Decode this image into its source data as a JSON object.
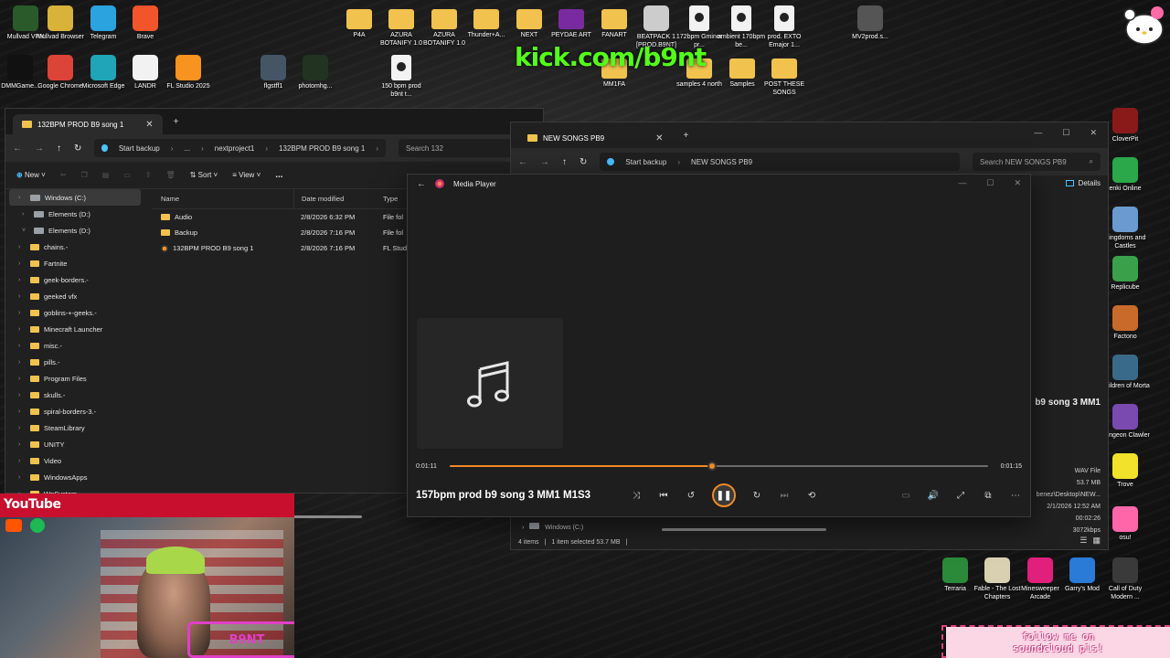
{
  "desktop": {
    "stream_logo": "kick.com/b9nt",
    "icons": [
      {
        "label": "Mullvad VPN",
        "kind": "app",
        "color": "#2a5a2a"
      },
      {
        "label": "Mullvad Browser",
        "kind": "app",
        "color": "#d9b23a"
      },
      {
        "label": "Telegram",
        "kind": "app",
        "color": "#2aa3df"
      },
      {
        "label": "Brave",
        "kind": "app",
        "color": "#f2552c"
      },
      {
        "label": "DMMGame...",
        "kind": "app",
        "color": "#111111"
      },
      {
        "label": "Google Chrome",
        "kind": "app",
        "color": "#db4437"
      },
      {
        "label": "Microsoft Edge",
        "kind": "app",
        "color": "#1fa4b8"
      },
      {
        "label": "LANDR",
        "kind": "app",
        "color": "#f2f2f2"
      },
      {
        "label": "FL Studio 2025",
        "kind": "app",
        "color": "#f7931e"
      },
      {
        "label": "flgstff1",
        "kind": "app",
        "color": "#445566"
      },
      {
        "label": "photomhg...",
        "kind": "app",
        "color": "#223322"
      },
      {
        "label": "150 bpm prod b9nt t...",
        "kind": "file",
        "color": "#f2f2f2"
      },
      {
        "label": "P4A",
        "kind": "folder",
        "color": "#f1c24d"
      },
      {
        "label": "AZURA BOTANIFY 1.0",
        "kind": "folder",
        "color": "#f1c24d"
      },
      {
        "label": "AZURA BOTANIFY 1.0",
        "kind": "folder",
        "color": "#f1c24d"
      },
      {
        "label": "Thunder+A...",
        "kind": "folder",
        "color": "#f1c24d"
      },
      {
        "label": "NEXT",
        "kind": "folder",
        "color": "#f1c24d"
      },
      {
        "label": "PEYDAE ART",
        "kind": "folder",
        "color": "#7a2aa0"
      },
      {
        "label": "FANART",
        "kind": "folder",
        "color": "#f1c24d"
      },
      {
        "label": "BEATPACK 1 [PROD.B9NT]",
        "kind": "app",
        "color": "#cccccc"
      },
      {
        "label": "172bpm Gminor pr...",
        "kind": "file",
        "color": "#f2f2f2"
      },
      {
        "label": "ambient 170bpm be...",
        "kind": "file",
        "color": "#f2f2f2"
      },
      {
        "label": "prod. EXTO Emajor 1...",
        "kind": "file",
        "color": "#f2f2f2"
      },
      {
        "label": "MV2prod.s...",
        "kind": "app",
        "color": "#555555"
      },
      {
        "label": "MM1FA",
        "kind": "folder",
        "color": "#f1c24d"
      },
      {
        "label": "samples 4 north",
        "kind": "folder",
        "color": "#f1c24d"
      },
      {
        "label": "Samples",
        "kind": "folder",
        "color": "#f1c24d"
      },
      {
        "label": "POST THESE SONGS",
        "kind": "folder",
        "color": "#f1c24d"
      },
      {
        "label": "CloverPit",
        "kind": "app",
        "color": "#8a1a1a"
      },
      {
        "label": "enki Online",
        "kind": "app",
        "color": "#2aa84a"
      },
      {
        "label": "Kingdoms and Castles",
        "kind": "app",
        "color": "#6a9ad0"
      },
      {
        "label": "Replicube",
        "kind": "app",
        "color": "#3aa04a"
      },
      {
        "label": "Factono",
        "kind": "app",
        "color": "#c86a2a"
      },
      {
        "label": "Children of Morta",
        "kind": "app",
        "color": "#3a6a8a"
      },
      {
        "label": "Dungeon Clawler",
        "kind": "app",
        "color": "#7a4ab0"
      },
      {
        "label": "Trove",
        "kind": "app",
        "color": "#f2e22a"
      },
      {
        "label": "osu!",
        "kind": "app",
        "color": "#ff66aa"
      },
      {
        "label": "Terraria",
        "kind": "app",
        "color": "#2a8a3a"
      },
      {
        "label": "Fable - The Lost Chapters",
        "kind": "app",
        "color": "#d8d0b0"
      },
      {
        "label": "Minesweeper Arcade",
        "kind": "app",
        "color": "#e0207a"
      },
      {
        "label": "Garry's Mod",
        "kind": "app",
        "color": "#2a7ad8"
      },
      {
        "label": "Call of Duty Modern ...",
        "kind": "app",
        "color": "#3a3a3a"
      }
    ]
  },
  "explorer1": {
    "tab_title": "132BPM PROD B9 song 1",
    "breadcrumb": [
      "Start backup",
      "...",
      "nextproject1",
      "132BPM PROD B9 song 1"
    ],
    "search_placeholder": "Search 132",
    "commands": {
      "new": "New",
      "sort": "Sort",
      "view": "View",
      "more": "..."
    },
    "tree": [
      {
        "label": "Windows (C:)",
        "kind": "drive",
        "selected": true
      },
      {
        "label": "Elements (D:)",
        "kind": "drive"
      },
      {
        "label": "Elements (D:)",
        "kind": "drive",
        "expanded": true
      },
      {
        "label": "chains.-",
        "kind": "folder"
      },
      {
        "label": "Fartnite",
        "kind": "folder"
      },
      {
        "label": "geek-borders.-",
        "kind": "folder"
      },
      {
        "label": "geeked vfx",
        "kind": "folder"
      },
      {
        "label": "goblins-+-geeks.-",
        "kind": "folder"
      },
      {
        "label": "Minecraft Launcher",
        "kind": "folder"
      },
      {
        "label": "misc.-",
        "kind": "folder"
      },
      {
        "label": "pills.-",
        "kind": "folder"
      },
      {
        "label": "Program Files",
        "kind": "folder"
      },
      {
        "label": "skulls.-",
        "kind": "folder"
      },
      {
        "label": "spiral-borders-3.-",
        "kind": "folder"
      },
      {
        "label": "SteamLibrary",
        "kind": "folder"
      },
      {
        "label": "UNITY",
        "kind": "folder"
      },
      {
        "label": "Video",
        "kind": "folder"
      },
      {
        "label": "WindowsApps",
        "kind": "folder"
      },
      {
        "label": "WpSystem",
        "kind": "folder"
      }
    ],
    "columns": {
      "name": "Name",
      "date": "Date modified",
      "type": "Type"
    },
    "files": [
      {
        "name": "Audio",
        "date": "2/8/2026 6:32 PM",
        "type": "File fol",
        "kind": "folder"
      },
      {
        "name": "Backup",
        "date": "2/8/2026 7:16 PM",
        "type": "File fol",
        "kind": "folder"
      },
      {
        "name": "132BPM PROD B9 song 1",
        "date": "2/8/2026 7:16 PM",
        "type": "FL Studi",
        "kind": "flp"
      }
    ]
  },
  "explorer2": {
    "tab_title": "NEW SONGS PB9",
    "breadcrumb": [
      "Start backup",
      "NEW SONGS PB9"
    ],
    "search_placeholder": "Search NEW SONGS PB9",
    "details_label": "Details",
    "details": {
      "song_name": "b9 song 3 MM1",
      "file_type": "WAV File",
      "size": "53.7 MB",
      "path": "benez\\Desktop\\NEW...",
      "date": "2/1/2026 12:52 AM",
      "length": "00:02:26",
      "bitrate": "3072kbps"
    },
    "tree_item": "Windows (C:)",
    "status": {
      "items": "4 items",
      "selected": "1 item selected  53.7 MB"
    }
  },
  "media_player": {
    "app_title": "Media Player",
    "now_playing": "157bpm prod b9 song 3 MM1 M1S3",
    "elapsed": "0:01:11",
    "duration": "0:01:15",
    "progress": 0.488,
    "accent": "#f08a24"
  },
  "overlay": {
    "youtube_label": "YouTube",
    "cam_tag": "B9NT",
    "follow_text_line1": "follow me on",
    "follow_text_line2": "soundcloud pls!"
  }
}
